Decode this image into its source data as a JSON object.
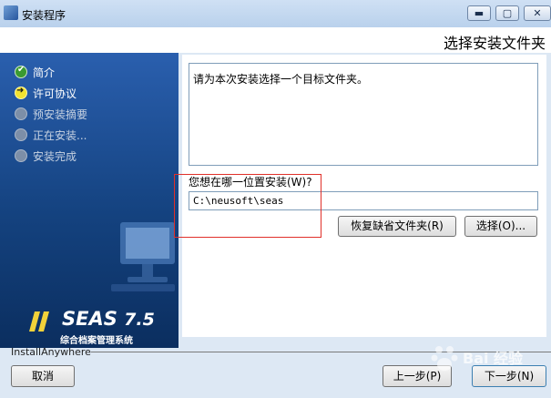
{
  "window": {
    "title": "安装程序",
    "min_glyph": "▬",
    "max_glyph": "▢",
    "close_glyph": "✕"
  },
  "header": {
    "title": "选择安装文件夹"
  },
  "steps": [
    {
      "label": "简介",
      "state": "done"
    },
    {
      "label": "许可协议",
      "state": "current"
    },
    {
      "label": "预安装摘要",
      "state": "pending"
    },
    {
      "label": "正在安装...",
      "state": "pending"
    },
    {
      "label": "安装完成",
      "state": "pending"
    }
  ],
  "brand": {
    "name": "SEAS",
    "version": "7.5",
    "subtitle": "综合档案管理系统"
  },
  "main": {
    "description": "请为本次安装选择一个目标文件夹。",
    "question": "您想在哪一位置安装(W)?",
    "install_path": "C:\\neusoft\\seas",
    "restore_button": "恢复缺省文件夹(R)",
    "choose_button": "选择(O)..."
  },
  "footer": {
    "vendor": "InstallAnywhere",
    "cancel_button": "取消",
    "prev_button": "上一步(P)",
    "next_button": "下一步(N)"
  },
  "watermark": {
    "text": "Bai 经验"
  },
  "colors": {
    "highlight_box": "#e0302a",
    "sidebar": "#14427f"
  }
}
